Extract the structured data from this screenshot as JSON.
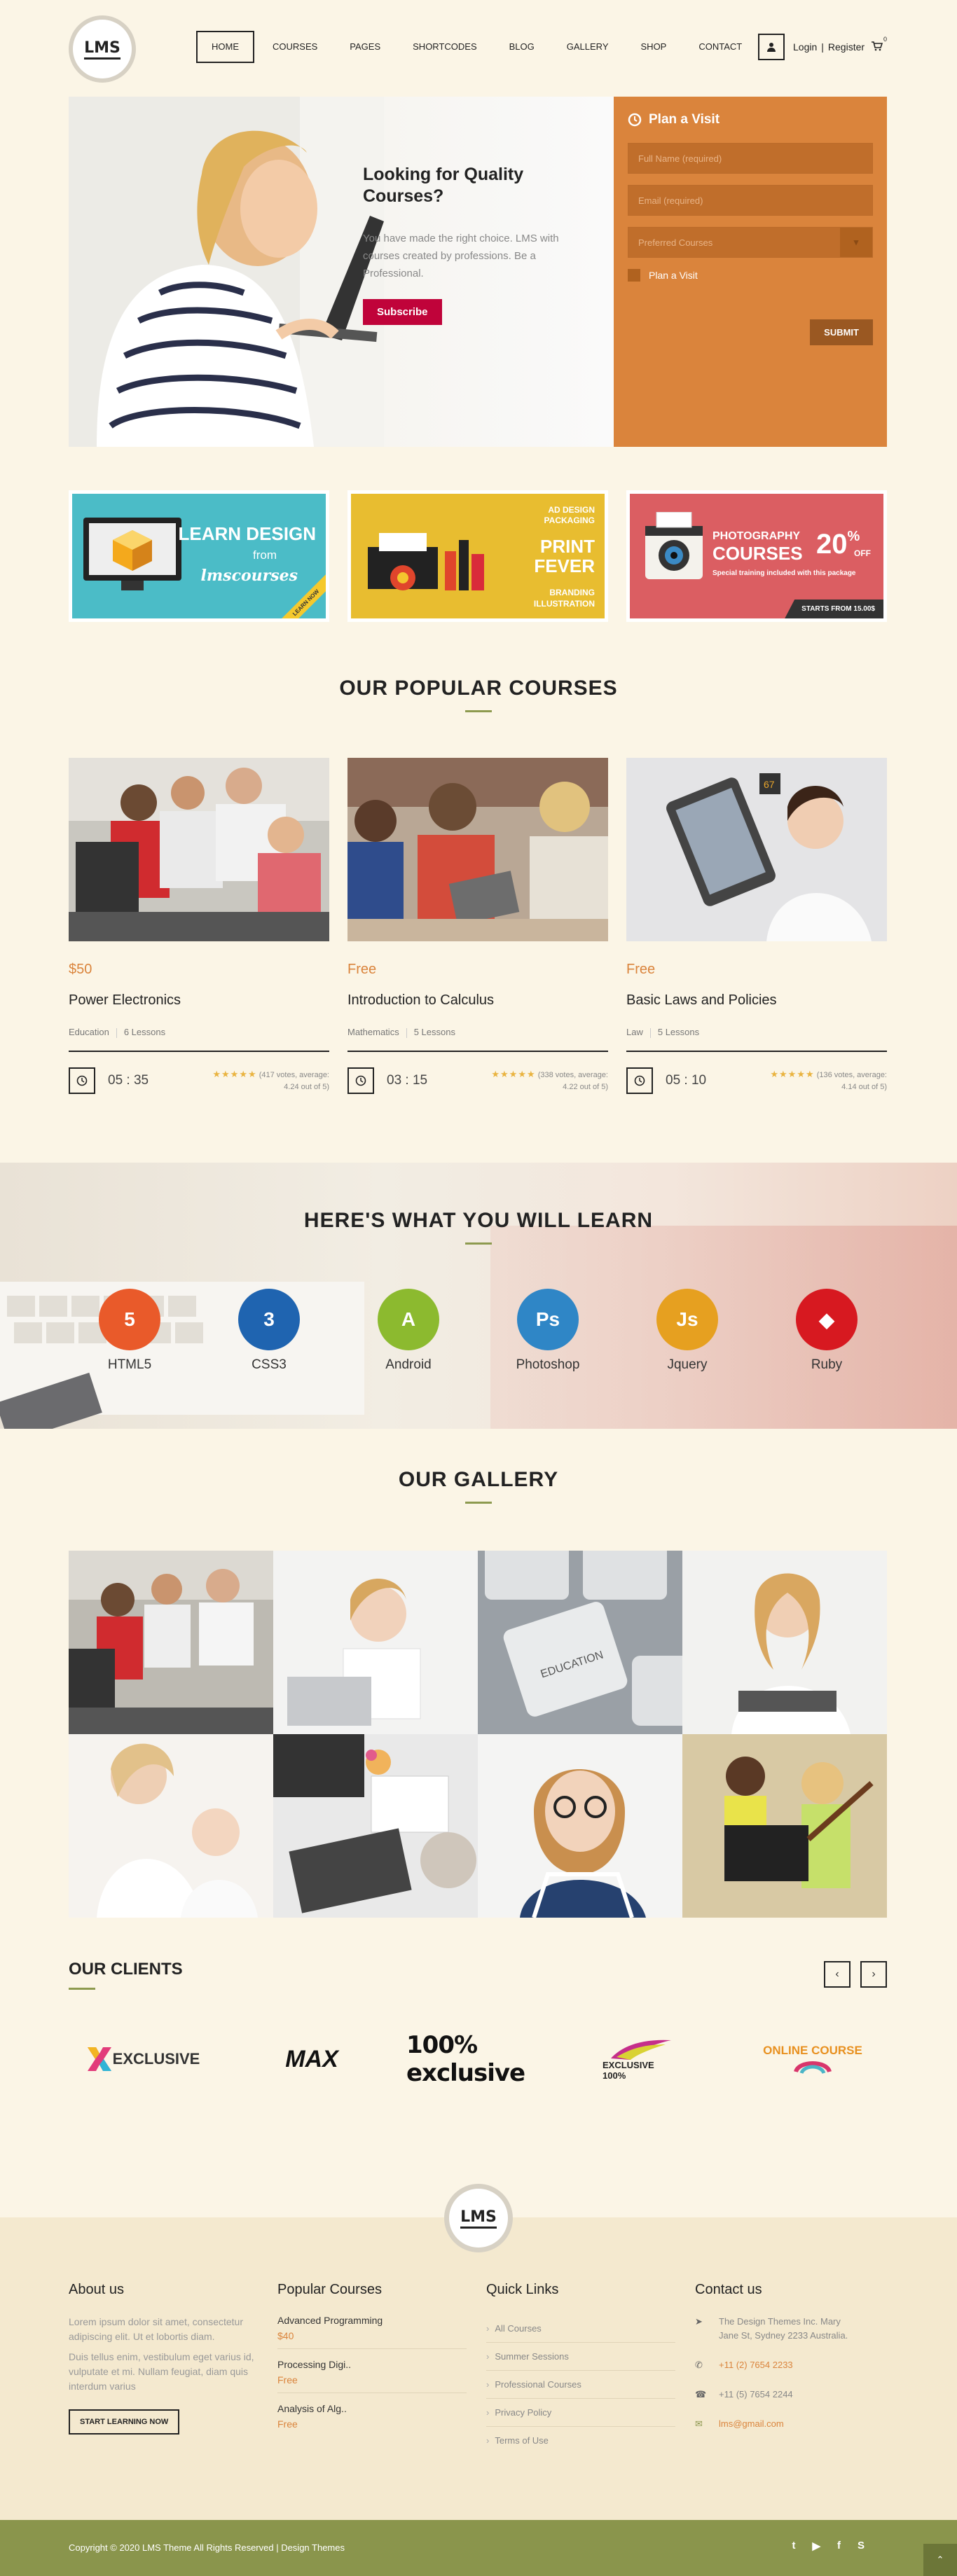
{
  "header": {
    "logo": "LMS",
    "nav": [
      "HOME",
      "COURSES",
      "PAGES",
      "SHORTCODES",
      "BLOG",
      "GALLERY",
      "SHOP",
      "CONTACT"
    ],
    "login": "Login",
    "separator": "|",
    "register": "Register",
    "cart_count": "0"
  },
  "hero": {
    "title": "Looking for Quality Courses?",
    "text": "You have made the right choice. LMS with courses created by professions. Be a Professional.",
    "button": "Subscribe"
  },
  "plan": {
    "title": "Plan a Visit",
    "full_name_placeholder": "Full Name (required)",
    "email_placeholder": "Email (required)",
    "course_select": "Preferred Courses",
    "checkbox_label": "Plan a Visit",
    "submit": "SUBMIT"
  },
  "banners": [
    {
      "line1": "LEARN DESIGN",
      "line2": "from",
      "line3": "lmscourses",
      "badge": "LEARN NOW",
      "color": "#4bbcc7"
    },
    {
      "line1": "AD DESIGN",
      "line2": "PACKAGING",
      "line3": "PRINT",
      "line4": "FEVER",
      "line5": "BRANDING",
      "line6": "ILLUSTRATION",
      "color": "#e8bd30"
    },
    {
      "line1": "PHOTOGRAPHY",
      "line2": "COURSES",
      "pct": "20",
      "pct_sign": "%",
      "off": "OFF",
      "sub": "Special training included with this package",
      "strip": "STARTS FROM 15.00$",
      "color": "#db5e62"
    }
  ],
  "popular": {
    "title": "OUR POPULAR COURSES",
    "courses": [
      {
        "price": "$50",
        "title": "Power Electronics",
        "category": "Education",
        "lessons": "6 Lessons",
        "time": "05 : 35",
        "votes": "(417 votes, average:",
        "avg": "4.24 out of 5)",
        "stars": "★★★★★"
      },
      {
        "price": "Free",
        "title": "Introduction to Calculus",
        "category": "Mathematics",
        "lessons": "5 Lessons",
        "time": "03 : 15",
        "votes": "(338 votes, average:",
        "avg": "4.22 out of 5)",
        "stars": "★★★★★"
      },
      {
        "price": "Free",
        "title": "Basic Laws and Policies",
        "category": "Law",
        "lessons": "5 Lessons",
        "time": "05 : 10",
        "votes": "(136 votes, average:",
        "avg": "4.14 out of 5)",
        "stars": "★★★★★"
      }
    ]
  },
  "learn": {
    "title": "HERE'S WHAT YOU WILL LEARN",
    "skills": [
      {
        "label": "HTML5",
        "glyph": "5",
        "color": "#e95a2a",
        "icon": "html5-icon"
      },
      {
        "label": "CSS3",
        "glyph": "3",
        "color": "#1f64b0",
        "icon": "css3-icon"
      },
      {
        "label": "Android",
        "glyph": "A",
        "color": "#8cba2f",
        "icon": "android-icon"
      },
      {
        "label": "Photoshop",
        "glyph": "Ps",
        "color": "#2f86c6",
        "icon": "photoshop-icon"
      },
      {
        "label": "Jquery",
        "glyph": "Js",
        "color": "#e6a020",
        "icon": "jquery-icon"
      },
      {
        "label": "Ruby",
        "glyph": "◆",
        "color": "#d71920",
        "icon": "ruby-icon"
      }
    ]
  },
  "gallery": {
    "title": "OUR GALLERY"
  },
  "clients": {
    "title": "OUR CLIENTS",
    "prev": "‹",
    "next": "›",
    "logos": [
      "EXCLUSIVE",
      "MAX",
      "100% exclusive",
      "EXCLUSIVE 100%",
      "ONLINE COURSE"
    ]
  },
  "footer": {
    "logo": "LMS",
    "about": {
      "title": "About us",
      "p1": "Lorem ipsum dolor sit amet, consectetur adipiscing elit. Ut et lobortis diam.",
      "p2": "Duis tellus enim, vestibulum eget varius id, vulputate et mi. Nullam feugiat, diam quis interdum varius",
      "button": "START LEARNING NOW"
    },
    "popular": {
      "title": "Popular Courses",
      "items": [
        {
          "name": "Advanced Programming",
          "price": "$40"
        },
        {
          "name": "Processing Digi..",
          "price": "Free"
        },
        {
          "name": "Analysis of Alg..",
          "price": "Free"
        }
      ]
    },
    "links": {
      "title": "Quick Links",
      "items": [
        "All Courses",
        "Summer Sessions",
        "Professional Courses",
        "Privacy Policy",
        "Terms of Use"
      ]
    },
    "contact": {
      "title": "Contact us",
      "address": "The Design Themes Inc. Mary Jane St, Sydney 2233 Australia.",
      "phone": "+11 (2) 7654 2233",
      "fax": "+11 (5) 7654 2244",
      "email": "lms@gmail.com"
    },
    "copyright": "Copyright © 2020 LMS Theme All Rights Reserved | Design Themes",
    "social": [
      "t",
      "▶",
      "f",
      "S"
    ]
  }
}
